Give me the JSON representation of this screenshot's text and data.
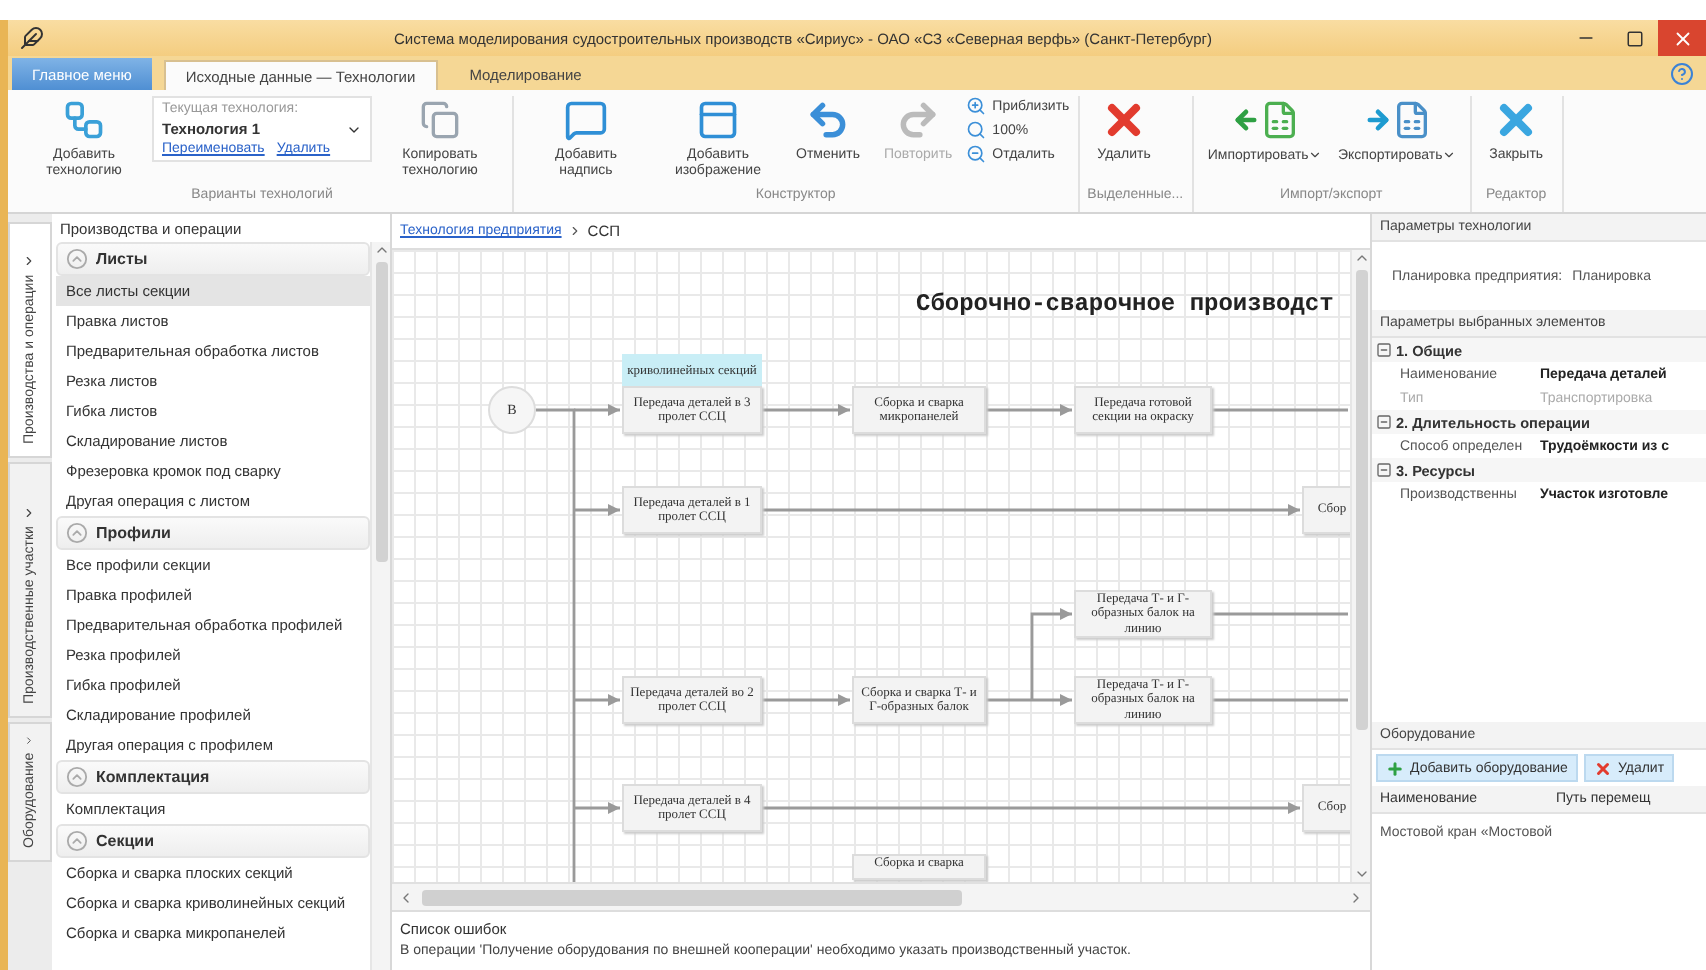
{
  "window": {
    "title": "Система моделирования судостроительных производств «Сириус» - ОАО «СЗ «Северная верфь» (Санкт-Петербург)"
  },
  "ribbon_tabs": [
    {
      "label": "Главное меню",
      "kind": "app",
      "selected": false
    },
    {
      "label": "Исходные данные — Технологии",
      "kind": "tab",
      "selected": true
    },
    {
      "label": "Моделирование",
      "kind": "tab",
      "selected": false
    }
  ],
  "ribbon_groups": [
    {
      "title": "Варианты технологий",
      "items": [
        {
          "kind": "large",
          "label": "Добавить технологию",
          "disabled": false,
          "dropdown": false
        },
        {
          "kind": "combo",
          "caption": "Текущая технология:",
          "value": "Технология 1",
          "links": [
            "Переименовать",
            "Удалить"
          ]
        },
        {
          "kind": "large",
          "label": "Копировать технологию",
          "disabled": false,
          "dropdown": false
        }
      ]
    },
    {
      "title": "Конструктор",
      "items": [
        {
          "kind": "large",
          "label": "Добавить надпись",
          "disabled": false,
          "dropdown": false
        },
        {
          "kind": "large",
          "label": "Добавить изображение",
          "disabled": false,
          "dropdown": false
        },
        {
          "kind": "large",
          "label": "Отменить",
          "disabled": false,
          "dropdown": false
        },
        {
          "kind": "large",
          "label": "Повторить",
          "disabled": true,
          "dropdown": false
        },
        {
          "kind": "small",
          "labels": [
            "Приблизить",
            "100%",
            "Отдалить"
          ]
        }
      ]
    },
    {
      "title": "Выделенные...",
      "items": [
        {
          "kind": "large",
          "label": "Удалить",
          "disabled": false,
          "dropdown": false
        }
      ]
    },
    {
      "title": "Импорт/экспорт",
      "items": [
        {
          "kind": "large",
          "label": "Импортировать",
          "disabled": false,
          "dropdown": true
        },
        {
          "kind": "large",
          "label": "Экспортировать",
          "disabled": false,
          "dropdown": true
        }
      ]
    },
    {
      "title": "Редактор",
      "items": [
        {
          "kind": "large",
          "label": "Закрыть",
          "disabled": false,
          "dropdown": false
        }
      ]
    }
  ],
  "side_tabs": [
    {
      "label": "Производства и операции",
      "selected": true
    },
    {
      "label": "Производственные участки",
      "selected": false
    },
    {
      "label": "Оборудование",
      "selected": false
    }
  ],
  "operations_panel": {
    "title": "Производства и операции",
    "groups": [
      {
        "title": "Листы",
        "expanded": true,
        "items": [
          {
            "label": "Все листы секции",
            "selected": true
          },
          {
            "label": "Правка листов",
            "selected": false
          },
          {
            "label": "Предварительная обработка листов",
            "selected": false
          },
          {
            "label": "Резка листов",
            "selected": false
          },
          {
            "label": "Гибка листов",
            "selected": false
          },
          {
            "label": "Складирование листов",
            "selected": false
          },
          {
            "label": "Фрезеровка кромок под сварку",
            "selected": false
          },
          {
            "label": "Другая операция с листом",
            "selected": false
          }
        ]
      },
      {
        "title": "Профили",
        "expanded": true,
        "items": [
          {
            "label": "Все профили секции",
            "selected": false
          },
          {
            "label": "Правка профилей",
            "selected": false
          },
          {
            "label": "Предварительная обработка профилей",
            "selected": false
          },
          {
            "label": "Резка профилей",
            "selected": false
          },
          {
            "label": "Гибка профилей",
            "selected": false
          },
          {
            "label": "Складирование профилей",
            "selected": false
          },
          {
            "label": "Другая операция с профилем",
            "selected": false
          }
        ]
      },
      {
        "title": "Комплектация",
        "expanded": true,
        "items": [
          {
            "label": "Комплектация",
            "selected": false
          }
        ]
      },
      {
        "title": "Секции",
        "expanded": true,
        "items": [
          {
            "label": "Сборка и сварка плоских секций",
            "selected": false
          },
          {
            "label": "Сборка и сварка криволинейных секций",
            "selected": false
          },
          {
            "label": "Сборка и сварка микропанелей",
            "selected": false
          }
        ]
      }
    ]
  },
  "breadcrumb": {
    "link": "Технология предприятия",
    "current": "ССП"
  },
  "diagram": {
    "title": "Сборочно-сварочное производст",
    "start_node": "В",
    "top_label": "криволинейных секций",
    "nodes": [
      "Передача деталей в 3 пролет ССЦ",
      "Сборка и сварка микропанелей",
      "Передача готовой секции на окраску",
      "Передача деталей в 1 пролет ССЦ",
      "Сбор",
      "Передача Т- и Г-образных балок на линию",
      "Передача деталей во 2 пролет ССЦ",
      "Сборка и сварка Т- и Г-образных балок",
      "Передача Т- и Г-образных балок на линию",
      "Передача деталей в 4 пролет ССЦ",
      "Сбор",
      "Сборка и сварка"
    ]
  },
  "errors": {
    "title": "Список ошибок",
    "rows": [
      "В операции 'Получение оборудования по внешней кооперации' необходимо указать производственный участок."
    ]
  },
  "tech_params": {
    "title": "Параметры технологии",
    "label": "Планировка предприятия:",
    "value": "Планировка"
  },
  "element_params": {
    "title": "Параметры выбранных элементов",
    "groups": [
      {
        "title": "1. Общие",
        "expanded": true,
        "rows": [
          {
            "name": "Наименование",
            "value": "Передача деталей",
            "disabled": false
          },
          {
            "name": "Тип",
            "value": "Транспортировка",
            "disabled": true
          }
        ]
      },
      {
        "title": "2. Длительность операции",
        "expanded": true,
        "rows": [
          {
            "name": "Способ определен",
            "value": "Трудоёмкости из с",
            "disabled": false
          }
        ]
      },
      {
        "title": "3. Ресурсы",
        "expanded": true,
        "rows": [
          {
            "name": "Производственны",
            "value": "Участок изготовле",
            "disabled": false
          }
        ]
      }
    ]
  },
  "equipment": {
    "title": "Оборудование",
    "buttons": [
      {
        "label": "Добавить оборудование",
        "kind": "add"
      },
      {
        "label": "Удалит",
        "kind": "delete"
      }
    ],
    "columns": [
      "Наименование",
      "Путь перемещ"
    ],
    "rows": [
      [
        "Мостовой кран «Мостовой"
      ]
    ]
  }
}
